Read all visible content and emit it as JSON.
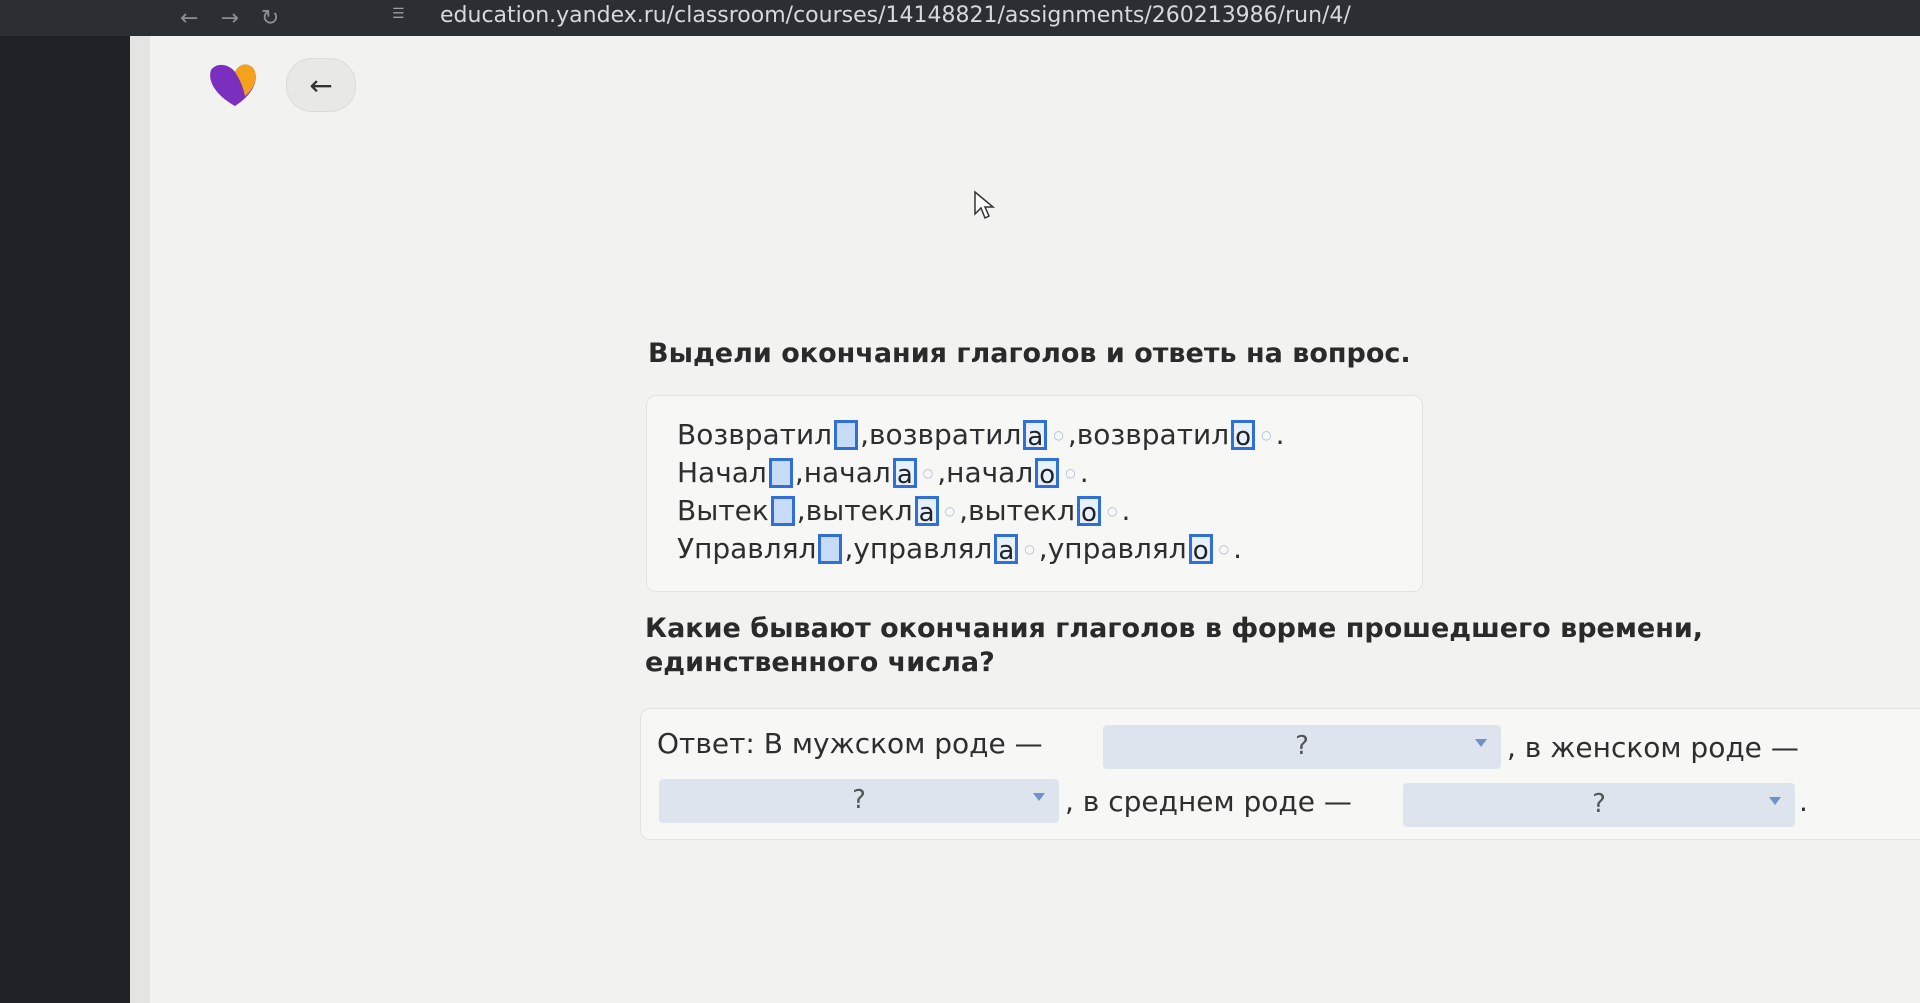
{
  "browser": {
    "url": "education.yandex.ru/classroom/courses/14148821/assignments/260213986/run/4/",
    "nav_back": "←",
    "nav_forward": "→",
    "reload": "↻"
  },
  "header": {
    "back_arrow": "←"
  },
  "task": {
    "title": "Выдели окончания глаголов и ответь на вопрос.",
    "lines": [
      {
        "parts": [
          {
            "stem": "Возвратил",
            "ending": "",
            "sep": ", "
          },
          {
            "stem": "возвратил",
            "ending": "а",
            "sep": " , "
          },
          {
            "stem": "возвратил",
            "ending": "о",
            "sep": " ."
          }
        ]
      },
      {
        "parts": [
          {
            "stem": "Начал",
            "ending": "",
            "sep": ", "
          },
          {
            "stem": "начал",
            "ending": "а",
            "sep": " , "
          },
          {
            "stem": "начал",
            "ending": "о",
            "sep": " ."
          }
        ]
      },
      {
        "parts": [
          {
            "stem": "Вытек",
            "ending": "",
            "sep": ", "
          },
          {
            "stem": "вытекл",
            "ending": "а",
            "sep": " , "
          },
          {
            "stem": "вытекл",
            "ending": "о",
            "sep": " ."
          }
        ]
      },
      {
        "parts": [
          {
            "stem": "Управлял",
            "ending": "",
            "sep": ", "
          },
          {
            "stem": "управлял",
            "ending": "а",
            "sep": " , "
          },
          {
            "stem": "управлял",
            "ending": "о",
            "sep": " ."
          }
        ]
      }
    ]
  },
  "question": {
    "text": "Какие бывают окончания глаголов в форме прошедшего времени, единственного числа?"
  },
  "answer": {
    "prefix": "Ответ: В мужском роде —",
    "feminine": ", в женском роде —",
    "neuter": ", в среднем роде —",
    "end": ".",
    "masculine_select": "?",
    "feminine_select": "?",
    "neuter_select": "?"
  },
  "colors": {
    "slot_border": "#2f6fd6",
    "select_bg": "#dde4ee"
  }
}
